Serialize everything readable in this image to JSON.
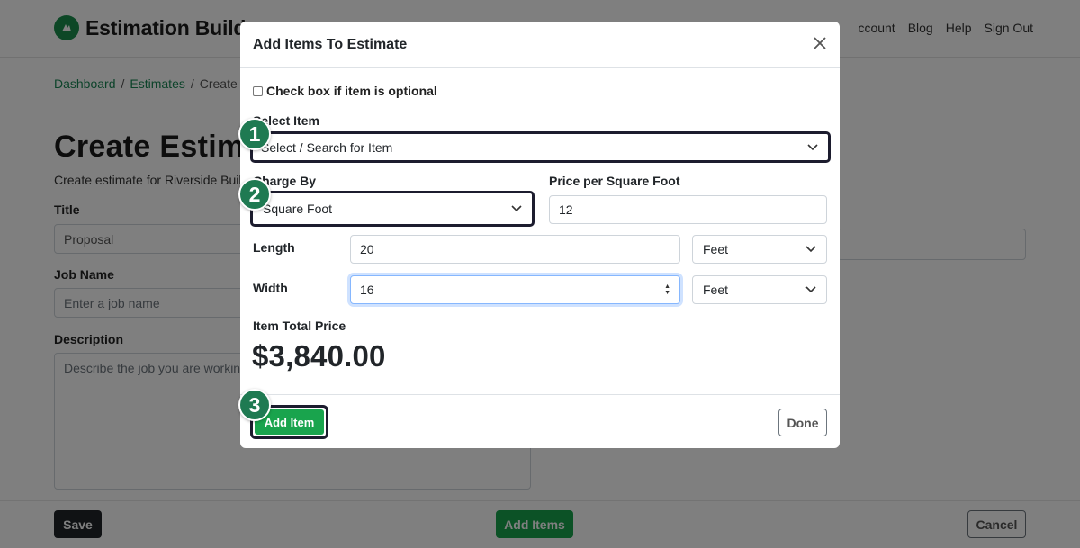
{
  "app": {
    "name": "Estimation Build",
    "nav": [
      "ccount",
      "Blog",
      "Help",
      "Sign Out"
    ]
  },
  "breadcrumb": {
    "dashboard": "Dashboard",
    "estimates": "Estimates",
    "current": "Create E",
    "separator": "/"
  },
  "page": {
    "title": "Create Estim",
    "subtitle": "Create estimate for Riverside Build",
    "title_label": "Title",
    "title_value": "Proposal",
    "job_name_label": "Job Name",
    "job_name_placeholder": "Enter a job name",
    "description_label": "Description",
    "description_placeholder": "Describe the job you are working"
  },
  "footer": {
    "save": "Save",
    "add_items": "Add Items",
    "cancel": "Cancel"
  },
  "modal": {
    "title": "Add Items To Estimate",
    "optional_checkbox_label": "Check box if item is optional",
    "optional_checked": false,
    "select_item_label": "Select Item",
    "select_item_value": "Select / Search for Item",
    "charge_by_label": "Charge By",
    "charge_by_value": "Square Foot",
    "price_label": "Price per Square Foot",
    "price_value": "12",
    "length_label": "Length",
    "length_value": "20",
    "length_unit": "Feet",
    "width_label": "Width",
    "width_value": "16",
    "width_unit": "Feet",
    "total_label": "Item Total Price",
    "total_value": "$3,840.00",
    "add_item_button": "Add Item",
    "done_button": "Done"
  },
  "steps": [
    "1",
    "2",
    "3"
  ],
  "colors": {
    "brand_green": "#198754",
    "button_green": "#19a44d",
    "step_badge": "#1f7a52",
    "highlight_outline": "#1c1c2e",
    "backdrop": "rgba(0,0,0,0.5)"
  }
}
